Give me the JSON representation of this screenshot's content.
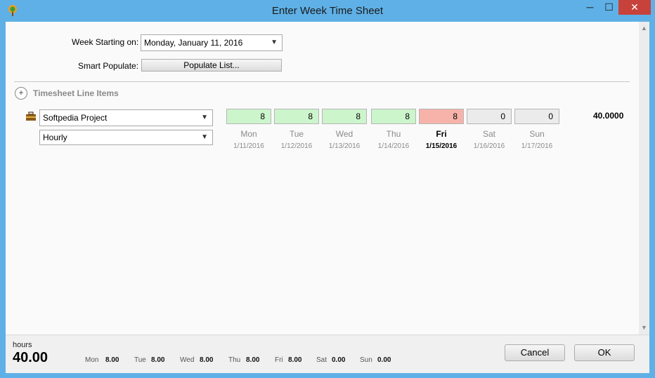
{
  "window": {
    "title": "Enter Week Time Sheet",
    "min_glyph": "─",
    "max_glyph": "☐",
    "close_glyph": "✕"
  },
  "week": {
    "label": "Week Starting on:",
    "value": "Monday, January 11, 2016"
  },
  "populate": {
    "label": "Smart Populate:",
    "button": "Populate List..."
  },
  "section": {
    "title": "Timesheet Line Items",
    "expand_glyph": "+"
  },
  "line": {
    "project": "Softpedia Project",
    "rate": "Hourly",
    "total": "40.0000",
    "days": [
      {
        "name": "Mon",
        "date": "1/11/2016",
        "hours": "8",
        "color": "#ccf5cc"
      },
      {
        "name": "Tue",
        "date": "1/12/2016",
        "hours": "8",
        "color": "#ccf5cc"
      },
      {
        "name": "Wed",
        "date": "1/13/2016",
        "hours": "8",
        "color": "#ccf5cc"
      },
      {
        "name": "Thu",
        "date": "1/14/2016",
        "hours": "8",
        "color": "#ccf5cc"
      },
      {
        "name": "Fri",
        "date": "1/15/2016",
        "hours": "8",
        "color": "#f7b3aa"
      },
      {
        "name": "Sat",
        "date": "1/16/2016",
        "hours": "0",
        "color": "#ebebeb"
      },
      {
        "name": "Sun",
        "date": "1/17/2016",
        "hours": "0",
        "color": "#ebebeb"
      }
    ]
  },
  "footer": {
    "hours_label": "hours",
    "hours_value": "40.00",
    "summary": [
      {
        "day": "Mon",
        "value": "8.00"
      },
      {
        "day": "Tue",
        "value": "8.00"
      },
      {
        "day": "Wed",
        "value": "8.00"
      },
      {
        "day": "Thu",
        "value": "8.00"
      },
      {
        "day": "Fri",
        "value": "8.00"
      },
      {
        "day": "Sat",
        "value": "0.00"
      },
      {
        "day": "Sun",
        "value": "0.00"
      }
    ],
    "cancel": "Cancel",
    "ok": "OK"
  },
  "icons": {
    "app": "app-tree-icon",
    "project": "project-briefcase-icon"
  },
  "colors": {
    "title_bar": "#5fb0e6",
    "close": "#c7423a"
  }
}
